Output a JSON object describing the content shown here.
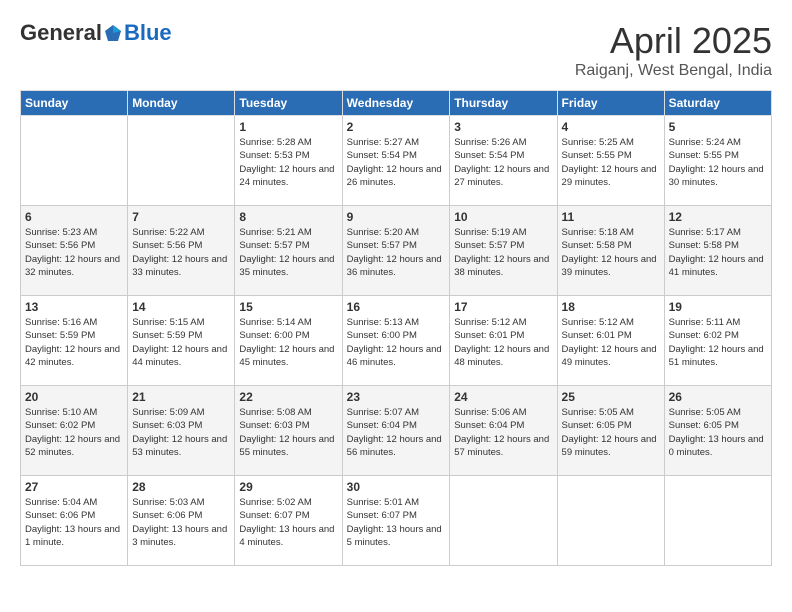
{
  "logo": {
    "general": "General",
    "blue": "Blue"
  },
  "title": "April 2025",
  "location": "Raiganj, West Bengal, India",
  "days_header": [
    "Sunday",
    "Monday",
    "Tuesday",
    "Wednesday",
    "Thursday",
    "Friday",
    "Saturday"
  ],
  "weeks": [
    [
      {
        "day": "",
        "info": ""
      },
      {
        "day": "",
        "info": ""
      },
      {
        "day": "1",
        "info": "Sunrise: 5:28 AM\nSunset: 5:53 PM\nDaylight: 12 hours and 24 minutes."
      },
      {
        "day": "2",
        "info": "Sunrise: 5:27 AM\nSunset: 5:54 PM\nDaylight: 12 hours and 26 minutes."
      },
      {
        "day": "3",
        "info": "Sunrise: 5:26 AM\nSunset: 5:54 PM\nDaylight: 12 hours and 27 minutes."
      },
      {
        "day": "4",
        "info": "Sunrise: 5:25 AM\nSunset: 5:55 PM\nDaylight: 12 hours and 29 minutes."
      },
      {
        "day": "5",
        "info": "Sunrise: 5:24 AM\nSunset: 5:55 PM\nDaylight: 12 hours and 30 minutes."
      }
    ],
    [
      {
        "day": "6",
        "info": "Sunrise: 5:23 AM\nSunset: 5:56 PM\nDaylight: 12 hours and 32 minutes."
      },
      {
        "day": "7",
        "info": "Sunrise: 5:22 AM\nSunset: 5:56 PM\nDaylight: 12 hours and 33 minutes."
      },
      {
        "day": "8",
        "info": "Sunrise: 5:21 AM\nSunset: 5:57 PM\nDaylight: 12 hours and 35 minutes."
      },
      {
        "day": "9",
        "info": "Sunrise: 5:20 AM\nSunset: 5:57 PM\nDaylight: 12 hours and 36 minutes."
      },
      {
        "day": "10",
        "info": "Sunrise: 5:19 AM\nSunset: 5:57 PM\nDaylight: 12 hours and 38 minutes."
      },
      {
        "day": "11",
        "info": "Sunrise: 5:18 AM\nSunset: 5:58 PM\nDaylight: 12 hours and 39 minutes."
      },
      {
        "day": "12",
        "info": "Sunrise: 5:17 AM\nSunset: 5:58 PM\nDaylight: 12 hours and 41 minutes."
      }
    ],
    [
      {
        "day": "13",
        "info": "Sunrise: 5:16 AM\nSunset: 5:59 PM\nDaylight: 12 hours and 42 minutes."
      },
      {
        "day": "14",
        "info": "Sunrise: 5:15 AM\nSunset: 5:59 PM\nDaylight: 12 hours and 44 minutes."
      },
      {
        "day": "15",
        "info": "Sunrise: 5:14 AM\nSunset: 6:00 PM\nDaylight: 12 hours and 45 minutes."
      },
      {
        "day": "16",
        "info": "Sunrise: 5:13 AM\nSunset: 6:00 PM\nDaylight: 12 hours and 46 minutes."
      },
      {
        "day": "17",
        "info": "Sunrise: 5:12 AM\nSunset: 6:01 PM\nDaylight: 12 hours and 48 minutes."
      },
      {
        "day": "18",
        "info": "Sunrise: 5:12 AM\nSunset: 6:01 PM\nDaylight: 12 hours and 49 minutes."
      },
      {
        "day": "19",
        "info": "Sunrise: 5:11 AM\nSunset: 6:02 PM\nDaylight: 12 hours and 51 minutes."
      }
    ],
    [
      {
        "day": "20",
        "info": "Sunrise: 5:10 AM\nSunset: 6:02 PM\nDaylight: 12 hours and 52 minutes."
      },
      {
        "day": "21",
        "info": "Sunrise: 5:09 AM\nSunset: 6:03 PM\nDaylight: 12 hours and 53 minutes."
      },
      {
        "day": "22",
        "info": "Sunrise: 5:08 AM\nSunset: 6:03 PM\nDaylight: 12 hours and 55 minutes."
      },
      {
        "day": "23",
        "info": "Sunrise: 5:07 AM\nSunset: 6:04 PM\nDaylight: 12 hours and 56 minutes."
      },
      {
        "day": "24",
        "info": "Sunrise: 5:06 AM\nSunset: 6:04 PM\nDaylight: 12 hours and 57 minutes."
      },
      {
        "day": "25",
        "info": "Sunrise: 5:05 AM\nSunset: 6:05 PM\nDaylight: 12 hours and 59 minutes."
      },
      {
        "day": "26",
        "info": "Sunrise: 5:05 AM\nSunset: 6:05 PM\nDaylight: 13 hours and 0 minutes."
      }
    ],
    [
      {
        "day": "27",
        "info": "Sunrise: 5:04 AM\nSunset: 6:06 PM\nDaylight: 13 hours and 1 minute."
      },
      {
        "day": "28",
        "info": "Sunrise: 5:03 AM\nSunset: 6:06 PM\nDaylight: 13 hours and 3 minutes."
      },
      {
        "day": "29",
        "info": "Sunrise: 5:02 AM\nSunset: 6:07 PM\nDaylight: 13 hours and 4 minutes."
      },
      {
        "day": "30",
        "info": "Sunrise: 5:01 AM\nSunset: 6:07 PM\nDaylight: 13 hours and 5 minutes."
      },
      {
        "day": "",
        "info": ""
      },
      {
        "day": "",
        "info": ""
      },
      {
        "day": "",
        "info": ""
      }
    ]
  ]
}
